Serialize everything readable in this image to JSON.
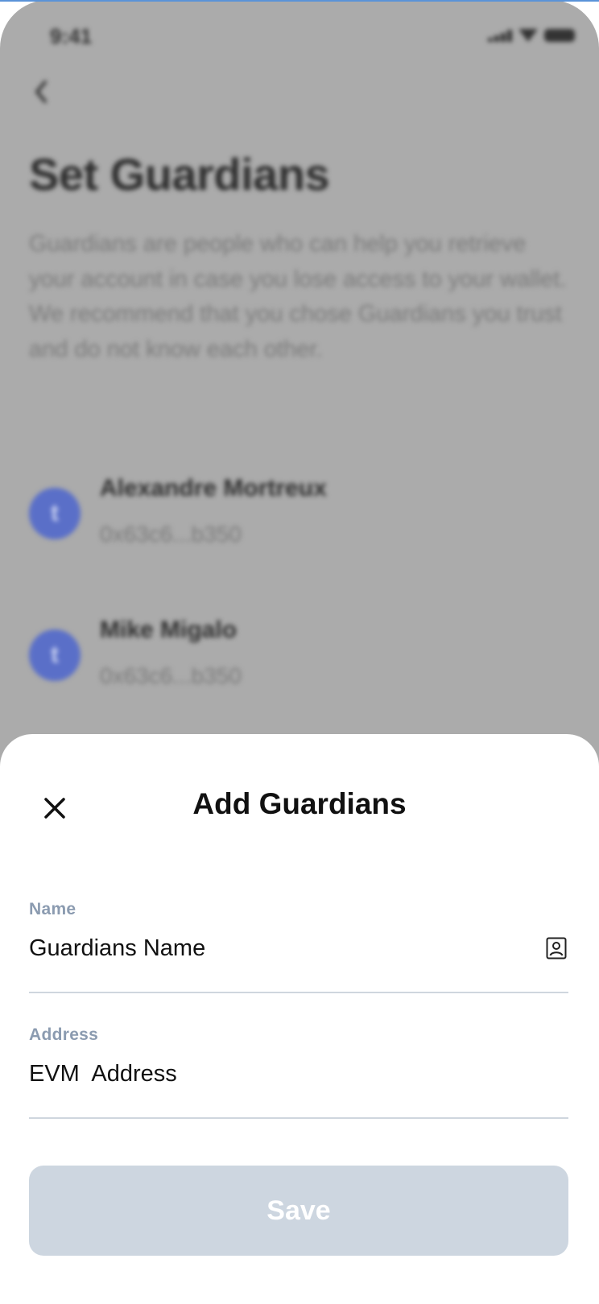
{
  "background": {
    "status_time": "9:41",
    "back_icon": "chevron-left-icon",
    "title": "Set Guardians",
    "description": "Guardians are people who can help you retrieve your account in case you lose access to your wallet. We recommend that you chose Guardians you trust and do not know each other.",
    "guardians": [
      {
        "name": "Alexandre Mortreux",
        "address": "0x63c6...b350",
        "avatar_initial": "t"
      },
      {
        "name": "Mike Migalo",
        "address": "0x63c6...b350",
        "avatar_initial": "t"
      }
    ]
  },
  "sheet": {
    "title": "Add Guardians",
    "close_icon": "close-icon",
    "name_field": {
      "label": "Name",
      "value": "Guardians Name",
      "icon": "contact-book-icon"
    },
    "address_field": {
      "label": "Address",
      "value": "EVM  Address"
    },
    "save_label": "Save"
  },
  "colors": {
    "overlay": "#ababab",
    "label": "#8b9bb0",
    "divider": "#cfd6de",
    "button_disabled": "#cdd6e0",
    "avatar": "#5a6fc8"
  }
}
